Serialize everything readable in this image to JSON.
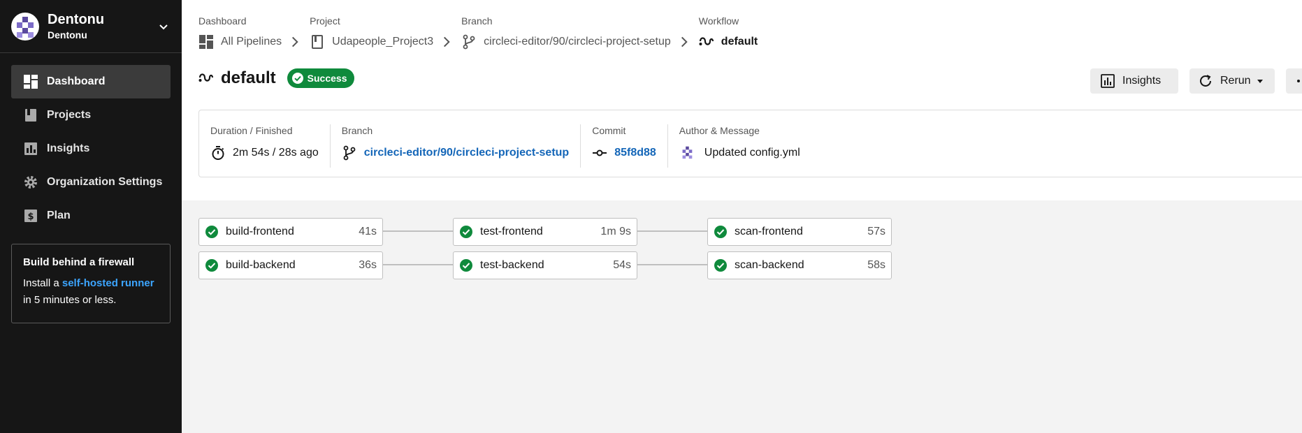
{
  "org": {
    "name": "Dentonu",
    "sub": "Dentonu"
  },
  "nav": [
    {
      "label": "Dashboard",
      "icon": "dashboard-icon",
      "active": true
    },
    {
      "label": "Projects",
      "icon": "book-icon"
    },
    {
      "label": "Insights",
      "icon": "bar-chart-icon"
    },
    {
      "label": "Organization Settings",
      "icon": "gear-icon"
    },
    {
      "label": "Plan",
      "icon": "dollar-icon"
    }
  ],
  "promo": {
    "title": "Build behind a firewall",
    "prefix": "Install a ",
    "link": "self-hosted runner",
    "suffix": "in 5 minutes or less."
  },
  "breadcrumb": [
    {
      "label": "Dashboard",
      "value": "All Pipelines",
      "icon": "dashboard-icon"
    },
    {
      "label": "Project",
      "value": "Udapeople_Project3",
      "icon": "book-icon"
    },
    {
      "label": "Branch",
      "value": "circleci-editor/90/circleci-project-setup",
      "icon": "branch-icon"
    },
    {
      "label": "Workflow",
      "value": "default",
      "icon": "workflow-icon"
    }
  ],
  "workflow": {
    "title": "default",
    "status": "Success"
  },
  "actions": {
    "insights": "Insights",
    "rerun": "Rerun"
  },
  "summary": {
    "duration_label": "Duration / Finished",
    "duration": "2m 54s / 28s ago",
    "branch_label": "Branch",
    "branch": "circleci-editor/90/circleci-project-setup",
    "commit_label": "Commit",
    "commit": "85f8d88",
    "author_label": "Author & Message",
    "message": "Updated config.yml"
  },
  "jobs": [
    {
      "name": "build-frontend",
      "duration": "41s"
    },
    {
      "name": "test-frontend",
      "duration": "1m 9s"
    },
    {
      "name": "scan-frontend",
      "duration": "57s"
    },
    {
      "name": "build-backend",
      "duration": "36s"
    },
    {
      "name": "test-backend",
      "duration": "54s"
    },
    {
      "name": "scan-backend",
      "duration": "58s"
    }
  ],
  "colors": {
    "success": "#0f8a3c",
    "link": "#1466b8",
    "sidebar": "#161616"
  }
}
